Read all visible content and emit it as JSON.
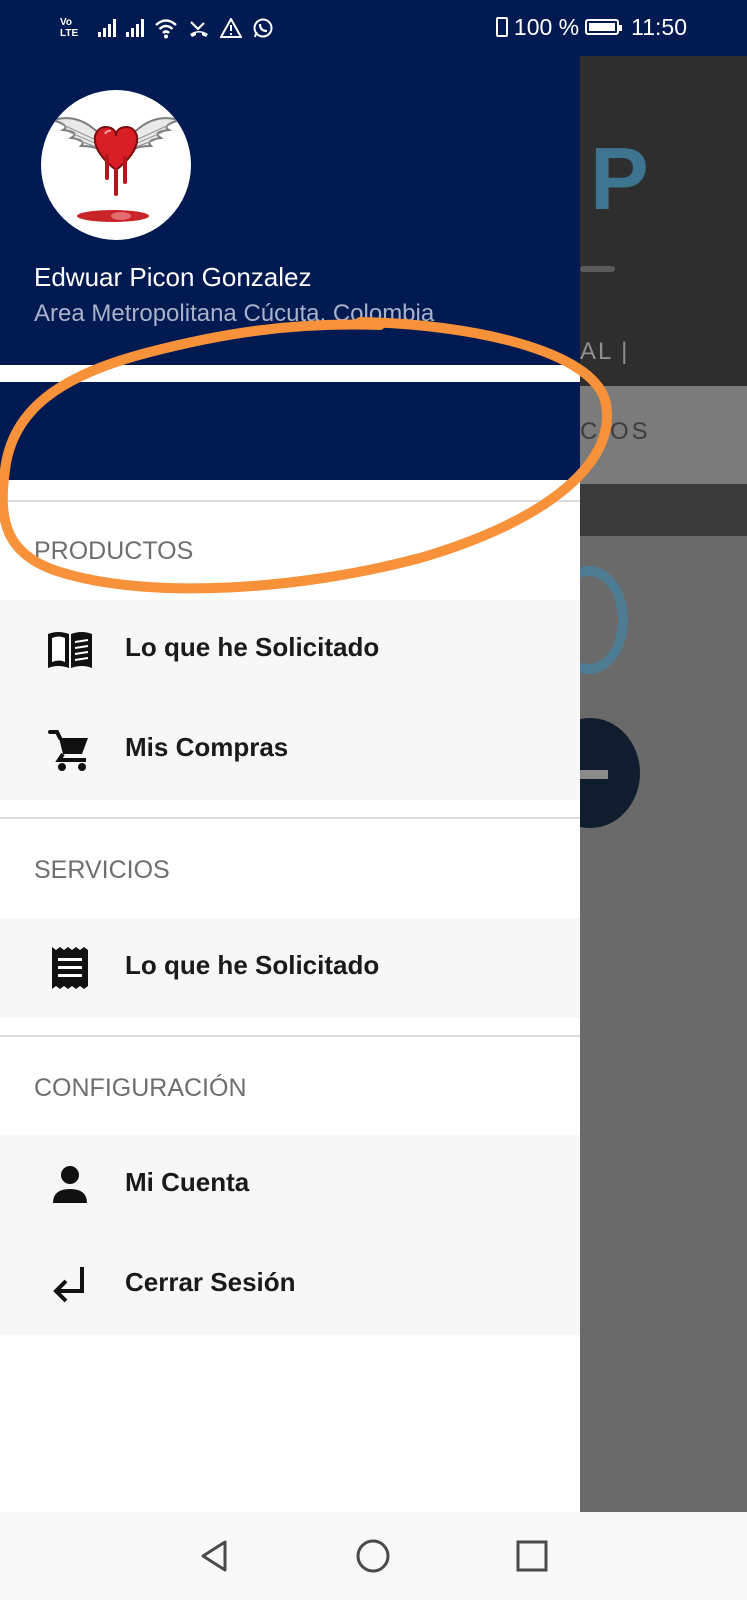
{
  "status_bar": {
    "network_label": "Vo LTE",
    "battery": "100 %",
    "time": "11:50"
  },
  "drawer": {
    "user_name": "Edwuar Picon Gonzalez",
    "user_location": "Area Metropolitana Cúcuta, Colombia",
    "sections": {
      "productos": {
        "title": "PRODUCTOS",
        "items": [
          {
            "label": "Lo que he Solicitado",
            "icon": "book-open-icon"
          },
          {
            "label": "Mis Compras",
            "icon": "shopping-cart-icon"
          }
        ]
      },
      "servicios": {
        "title": "SERVICIOS",
        "items": [
          {
            "label": "Lo que he Solicitado",
            "icon": "receipt-icon"
          }
        ]
      },
      "configuracion": {
        "title": "CONFIGURACIÓN",
        "items": [
          {
            "label": "Mi Cuenta",
            "icon": "person-icon"
          },
          {
            "label": "Cerrar Sesión",
            "icon": "logout-arrow-icon"
          }
        ]
      }
    }
  },
  "background_app": {
    "partial_text_1": "AL |",
    "partial_text_2": "CIOS"
  },
  "colors": {
    "header": "#021a52",
    "annotation": "#f7913a",
    "scrim": "#6a6a6a"
  }
}
